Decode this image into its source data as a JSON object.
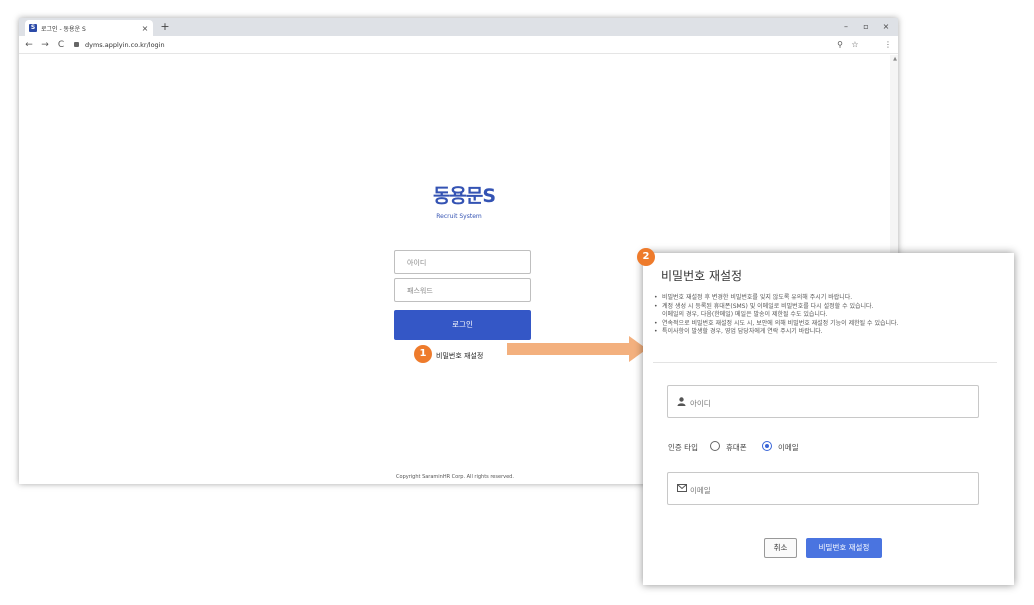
{
  "browser": {
    "tab_favicon": "S",
    "tab_title": "로그인 - 동용운 S",
    "tab_close": "×",
    "new_tab": "+",
    "minimize": "–",
    "maximize": "▫",
    "close": "×",
    "back": "←",
    "forward": "→",
    "reload": "C",
    "url": "dyms.applyin.co.kr/login",
    "zoom_icon": "⚲",
    "star_icon": "☆",
    "menu_icon": "⋮"
  },
  "login": {
    "logo": "동용문S",
    "logo_sub": "Recruit System",
    "id_placeholder": "아이디",
    "pw_placeholder": "패스워드",
    "login_button": "로그인",
    "reset_link": "비밀번호 재설정",
    "copyright": "Copyright SaraminHR Corp. All rights reserved."
  },
  "steps": [
    "1",
    "2"
  ],
  "modal": {
    "title": "비밀번호 재설정",
    "notices": [
      {
        "text": "비밀번호 재설정 후 변경한 비밀번호를 잊지 않도록 유의해 주시기 바랍니다.",
        "bullet": true
      },
      {
        "text": "계정 생성 시 등록된 휴대폰(SMS) 및 이메일로 비밀번호를 다시 설정할 수 있습니다.",
        "bullet": true
      },
      {
        "text": "이메일의 경우, 다음(한메일) 메일은 발송이 제한될 수도 있습니다.",
        "bullet": false
      },
      {
        "text": "연속적으로 비밀번호 재설정 시도 시, 보안에 의해 비밀번호 재설정 기능이 제한될 수 있습니다.",
        "bullet": true
      },
      {
        "text": "특이사항이 발생할 경우, 영업 담당자에게 연락 주시기 바랍니다.",
        "bullet": true
      }
    ],
    "id_placeholder": "아이디",
    "auth_type_label": "인증 타입",
    "option_phone": "휴대폰",
    "option_email": "이메일",
    "selected_option": "이메일",
    "email_placeholder": "이메일",
    "cancel_button": "취소",
    "submit_button": "비밀번호 재설정"
  },
  "colors": {
    "brand": "#3453b3",
    "primary_button": "#3457c6",
    "modal_primary": "#4a74e0",
    "step_badge": "#ee7b2c",
    "arrow": "#f3b07e"
  }
}
